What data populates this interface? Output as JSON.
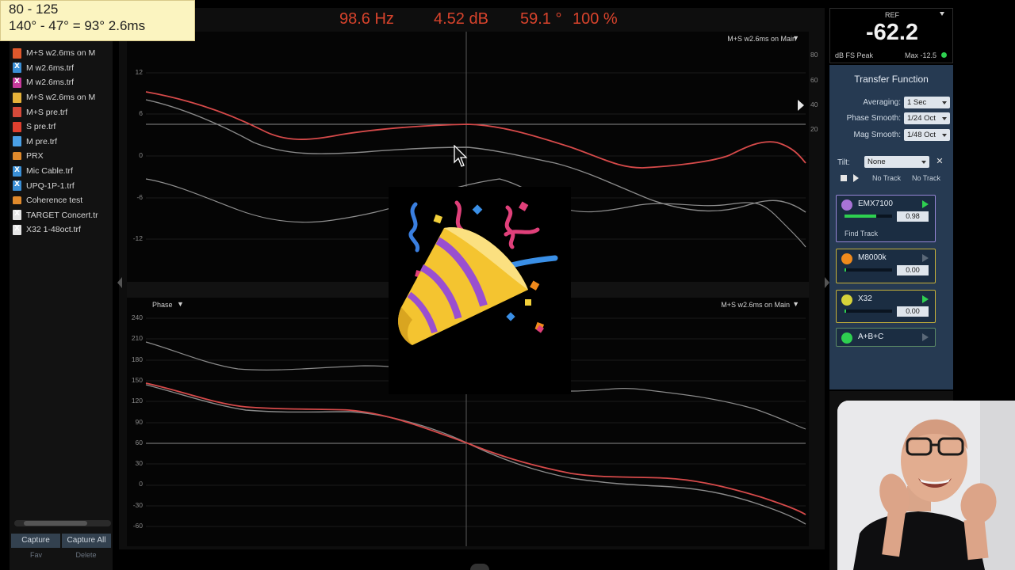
{
  "tooltip": {
    "line1": "80 - 125",
    "line2": "140° - 47° = 93° 2.6ms"
  },
  "readout": {
    "frequency": "98.6 Hz",
    "magnitude": "4.52 dB",
    "phase": "59.1 °",
    "coherence": "100 %",
    "color": "#d8432c"
  },
  "files": [
    {
      "name": "M+S w2.6ms on M",
      "icon": "file-orange-icon",
      "color": "#e0582c"
    },
    {
      "name": "M w2.6ms.trf",
      "icon": "file-x-icon",
      "color": "#3a8fd6"
    },
    {
      "name": "M w2.6ms.trf",
      "icon": "file-x-icon",
      "color": "#c73a9b"
    },
    {
      "name": "M+S w2.6ms on M",
      "icon": "file-yellow-icon",
      "color": "#e6b23a"
    },
    {
      "name": "M+S pre.trf",
      "icon": "file-red-icon",
      "color": "#d64a3a"
    },
    {
      "name": "S pre.trf",
      "icon": "file-red-icon",
      "color": "#e0402f"
    },
    {
      "name": "M pre.trf",
      "icon": "file-blue-icon",
      "color": "#4aa0e6"
    },
    {
      "name": "PRX",
      "icon": "folder-icon",
      "color": "#e08a2c"
    },
    {
      "name": "Mic Cable.trf",
      "icon": "file-x-icon",
      "color": "#3a8fd6"
    },
    {
      "name": "UPQ-1P-1.trf",
      "icon": "file-x-icon",
      "color": "#3a8fd6"
    },
    {
      "name": "Coherence test",
      "icon": "folder-icon",
      "color": "#e08a2c"
    },
    {
      "name": "TARGET Concert.tr",
      "icon": "file-x-icon",
      "color": "#e6e6e6"
    },
    {
      "name": "X32 1-48oct.trf",
      "icon": "file-x-icon",
      "color": "#e6e6e6"
    }
  ],
  "capture": {
    "button1": "Capture",
    "button2": "Capture All",
    "sub1": "Fav",
    "sub2": "Delete"
  },
  "top_plot": {
    "trace_label": "M+S w2.6ms on Main",
    "y_ticks": [
      "12",
      "6",
      "0",
      "-6",
      "-12"
    ],
    "right_ticks": [
      "80",
      "60",
      "40",
      "20"
    ]
  },
  "bottom_plot": {
    "title": "Phase",
    "trace_label": "M+S w2.6ms on Main",
    "y_ticks": [
      "240",
      "210",
      "180",
      "150",
      "120",
      "90",
      "60",
      "30",
      "0",
      "-30",
      "-60"
    ]
  },
  "ref": {
    "title": "REF",
    "value": "-62.2",
    "unit": "dB FS Peak",
    "max": "Max -12.5",
    "status_color": "#2ed050"
  },
  "transfer_function": {
    "title": "Transfer Function",
    "rows": [
      {
        "label": "Averaging:",
        "value": "1 Sec"
      },
      {
        "label": "Phase Smooth:",
        "value": "1/24 Oct"
      },
      {
        "label": "Mag Smooth:",
        "value": "1/48 Oct"
      }
    ],
    "tilt_label": "Tilt:",
    "tilt_value": "None",
    "no_track_1": "No Track",
    "no_track_2": "No Track"
  },
  "measurements": [
    {
      "name": "EMX7100",
      "value": "0.98",
      "sub": "Find  Track",
      "dot_color": "#a873d6",
      "active": true
    },
    {
      "name": "M8000k",
      "value": "0.00",
      "dot_color": "#f08a1c",
      "active": false
    },
    {
      "name": "X32",
      "value": "0.00",
      "dot_color": "#d6d23a",
      "active": true
    },
    {
      "name": "A+B+C",
      "dot_color": "#2ed050",
      "active": false
    }
  ]
}
